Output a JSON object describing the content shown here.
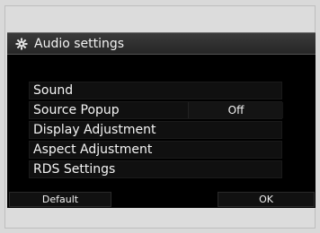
{
  "window": {
    "title": "Audio settings",
    "icon": "gear-icon"
  },
  "menu": {
    "items": [
      {
        "label": "Sound",
        "value": ""
      },
      {
        "label": "Source Popup",
        "value": "Off"
      },
      {
        "label": "Display Adjustment",
        "value": ""
      },
      {
        "label": "Aspect Adjustment",
        "value": ""
      },
      {
        "label": "RDS Settings",
        "value": ""
      }
    ]
  },
  "footer": {
    "default_label": "Default",
    "ok_label": "OK"
  },
  "colors": {
    "screen_bg": "#000000",
    "text": "#f5f5f5",
    "frame_bg": "#dcdcdc"
  }
}
